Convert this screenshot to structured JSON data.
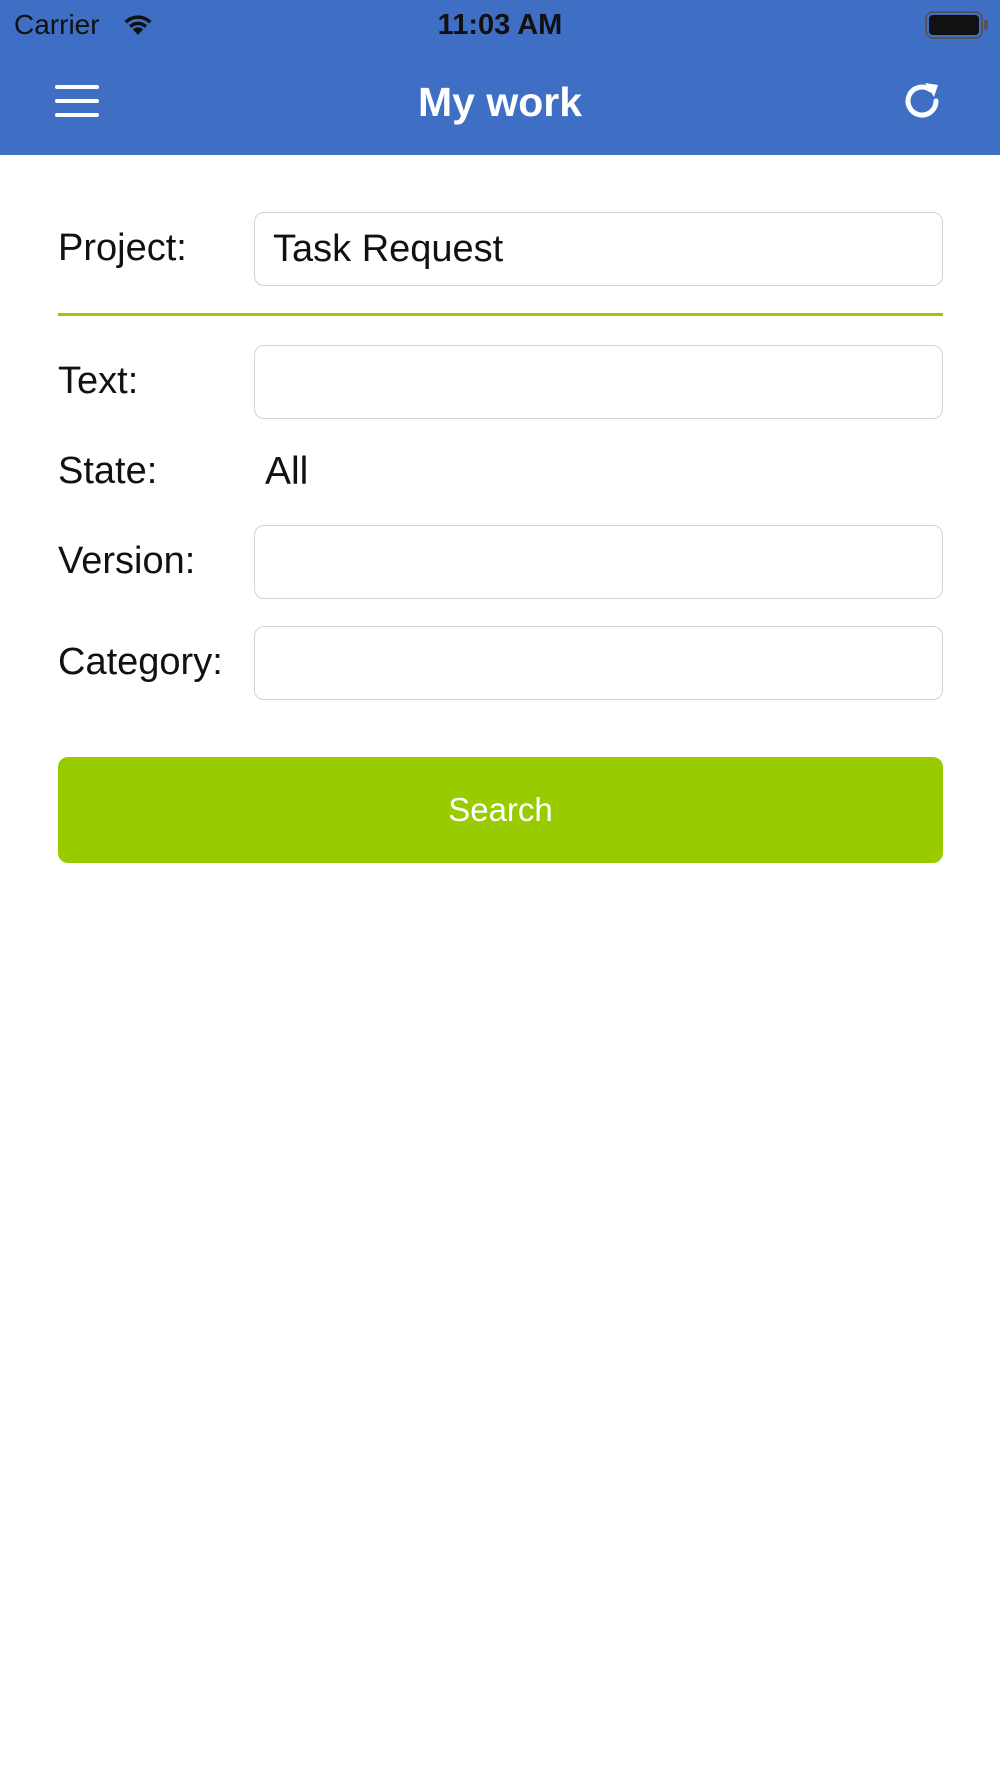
{
  "status_bar": {
    "carrier": "Carrier",
    "time": "11:03 AM",
    "wifi_icon": "wifi-icon",
    "battery_icon": "battery-icon"
  },
  "nav": {
    "title": "My work",
    "menu_icon": "menu-icon",
    "refresh_icon": "refresh-icon",
    "background_color": "#3f6fc4"
  },
  "form": {
    "project": {
      "label": "Project:",
      "value": "Task Request"
    },
    "text": {
      "label": "Text:",
      "value": ""
    },
    "state": {
      "label": "State:",
      "value": "All"
    },
    "version": {
      "label": "Version:",
      "value": ""
    },
    "category": {
      "label": "Category:",
      "value": ""
    },
    "divider_color": "#9acb00"
  },
  "search_button": {
    "label": "Search",
    "color": "#99cc00"
  }
}
